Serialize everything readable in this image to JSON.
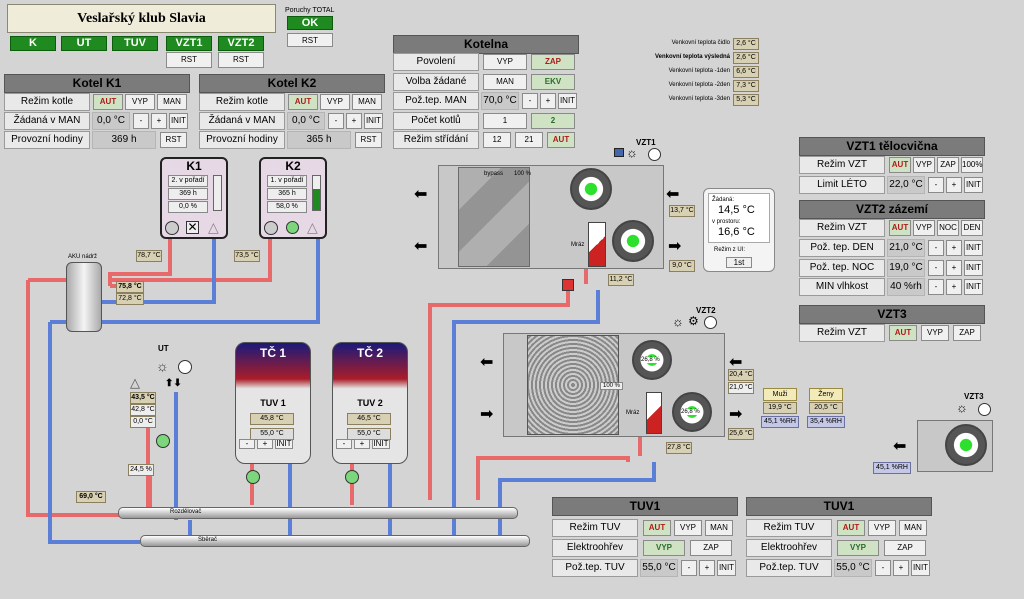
{
  "title": "Veslařský klub Slavia",
  "faults": {
    "label": "Poruchy TOTAL",
    "status": "OK",
    "rst": "RST"
  },
  "nav": {
    "k": "K",
    "ut": "UT",
    "tuv": "TUV",
    "vzt1": "VZT1",
    "vzt2": "VZT2",
    "rst": "RST"
  },
  "kotel1": {
    "title": "Kotel K1",
    "rezim": "Režim kotle",
    "zad": "Žádaná v MAN",
    "hod": "Provozní hodiny",
    "aut": "AUT",
    "vyp": "VYP",
    "man": "MAN",
    "zad_val": "0,0 °C",
    "minus": "-",
    "plus": "+",
    "init": "INIT",
    "hod_val": "369 h",
    "rst": "RST"
  },
  "kotel2": {
    "title": "Kotel K2",
    "rezim": "Režim kotle",
    "zad": "Žádaná v MAN",
    "hod": "Provozní hodiny",
    "aut": "AUT",
    "vyp": "VYP",
    "man": "MAN",
    "zad_val": "0,0 °C",
    "minus": "-",
    "plus": "+",
    "init": "INIT",
    "hod_val": "365 h",
    "rst": "RST"
  },
  "kotelna": {
    "title": "Kotelna",
    "povoleni": "Povolení",
    "vyp": "VYP",
    "zap": "ZAP",
    "volba": "Volba žádané",
    "man": "MAN",
    "ekv": "EKV",
    "poz": "Pož.tep. MAN",
    "poz_val": "70,0 °C",
    "minus": "-",
    "plus": "+",
    "init": "INIT",
    "pocet": "Počet kotlů",
    "p1": "1",
    "p2": "2",
    "strid": "Režim střídání",
    "s1": "12",
    "s2": "21",
    "aut": "AUT"
  },
  "weather": [
    {
      "label": "Venkovní teplota čidlo",
      "value": "2,6 °C"
    },
    {
      "label": "Venkovní teplota výsledná",
      "value": "2,6 °C"
    },
    {
      "label": "Venkovní teplota -1den",
      "value": "6,6 °C"
    },
    {
      "label": "Venkovní teplota -2den",
      "value": "7,3 °C"
    },
    {
      "label": "Venkovní teplota -3den",
      "value": "5,3 °C"
    }
  ],
  "vzt1panel": {
    "title": "VZT1 tělocvična",
    "rezim": "Režim VZT",
    "aut": "AUT",
    "vyp": "VYP",
    "zap": "ZAP",
    "pct": "100%",
    "limit": "Limit LÉTO",
    "limit_val": "22,0 °C",
    "minus": "-",
    "plus": "+",
    "init": "INIT"
  },
  "vzt2panel": {
    "title": "VZT2 zázemí",
    "rezim": "Režim VZT",
    "aut": "AUT",
    "vyp": "VYP",
    "noc": "NOC",
    "den": "DEN",
    "pden": "Pož. tep. DEN",
    "pden_val": "21,0 °C",
    "pnoc": "Pož. tep. NOC",
    "pnoc_val": "19,0 °C",
    "vlh": "MIN vlhkost",
    "vlh_val": "40 %rh",
    "minus": "-",
    "plus": "+",
    "init": "INIT"
  },
  "vzt3panel": {
    "title": "VZT3",
    "rezim": "Režim VZT",
    "aut": "AUT",
    "vyp": "VYP",
    "zap": "ZAP"
  },
  "k1box": {
    "name": "K1",
    "order": "2. v pořadí",
    "hours": "369 h",
    "pct": "0,0 %"
  },
  "k2box": {
    "name": "K2",
    "order": "1. v pořadí",
    "hours": "365 h",
    "pct": "58,0 %"
  },
  "temps": {
    "k1out": "78,7 °C",
    "k2out": "73,5 °C",
    "aku_top": "75,8 °C",
    "aku_bot": "72,8 °C",
    "ut_a": "43,5 °C",
    "ut_b": "42,8 °C",
    "ut_c": "0,0 °C",
    "ut_pct": "24,5 %",
    "rozd": "69,0 °C",
    "vzt1_out": "13,7 °C",
    "vzt1_sup": "9,0 °C",
    "vzt1_hw": "11,2 °C",
    "vzt2_a": "20,4 °C",
    "vzt2_b": "21,0 °C",
    "vzt2_c": "25,6 °C",
    "vzt2_hw": "27,8 °C",
    "vzt2_fan1": "26,8 %",
    "vzt2_fan2": "26,8 %",
    "vzt2_bypass": "100 %",
    "vzt3_rh": "45,1 %RH"
  },
  "rooms": {
    "muzi": "Muži",
    "zeny": "Ženy",
    "muzi_t": "19,9 °C",
    "zeny_t": "20,5 °C",
    "muzi_rh": "45,1 %RH",
    "zeny_rh": "35,4 %RH"
  },
  "thermostat": {
    "zad_label": "Žádaná:",
    "zad": "14,5 °C",
    "prost_label": "v prostoru:",
    "prost": "16,6 °C",
    "rezim": "Režim z UI:",
    "rezim_val": "1st"
  },
  "labels": {
    "aku": "AKU nádrž",
    "ut": "UT",
    "vzt1": "VZT1",
    "vzt2": "VZT2",
    "vzt3": "VZT3",
    "bypass": "bypass",
    "bypass_pct": "100 %",
    "mraz": "Mráz",
    "rozdelovac": "Rozdělovač",
    "sberac": "Sběrač",
    "tc1": "TČ 1",
    "tc2": "TČ 2"
  },
  "tuv1": {
    "title": "TUV 1",
    "temp": "45,8 °C",
    "setp": "55,0 °C",
    "minus": "-",
    "plus": "+",
    "init": "INIT"
  },
  "tuv2": {
    "title": "TUV 2",
    "temp": "46,5 °C",
    "setp": "55,0 °C",
    "minus": "-",
    "plus": "+",
    "init": "INIT"
  },
  "tuvpanelA": {
    "title": "TUV1",
    "rezim": "Režim TUV",
    "aut": "AUT",
    "vyp": "VYP",
    "man": "MAN",
    "elek": "Elektroohřev",
    "e_vyp": "VYP",
    "e_zap": "ZAP",
    "poz": "Pož.tep. TUV",
    "poz_val": "55,0 °C",
    "minus": "-",
    "plus": "+",
    "init": "INIT"
  },
  "tuvpanelB": {
    "title": "TUV1",
    "rezim": "Režim TUV",
    "aut": "AUT",
    "vyp": "VYP",
    "man": "MAN",
    "elek": "Elektroohřev",
    "e_vyp": "VYP",
    "e_zap": "ZAP",
    "poz": "Pož.tep. TUV",
    "poz_val": "55,0 °C",
    "minus": "-",
    "plus": "+",
    "init": "INIT"
  },
  "colors": {
    "hot": "#e8696a",
    "cold": "#5b7fd6",
    "green": "#1f8a1f"
  }
}
